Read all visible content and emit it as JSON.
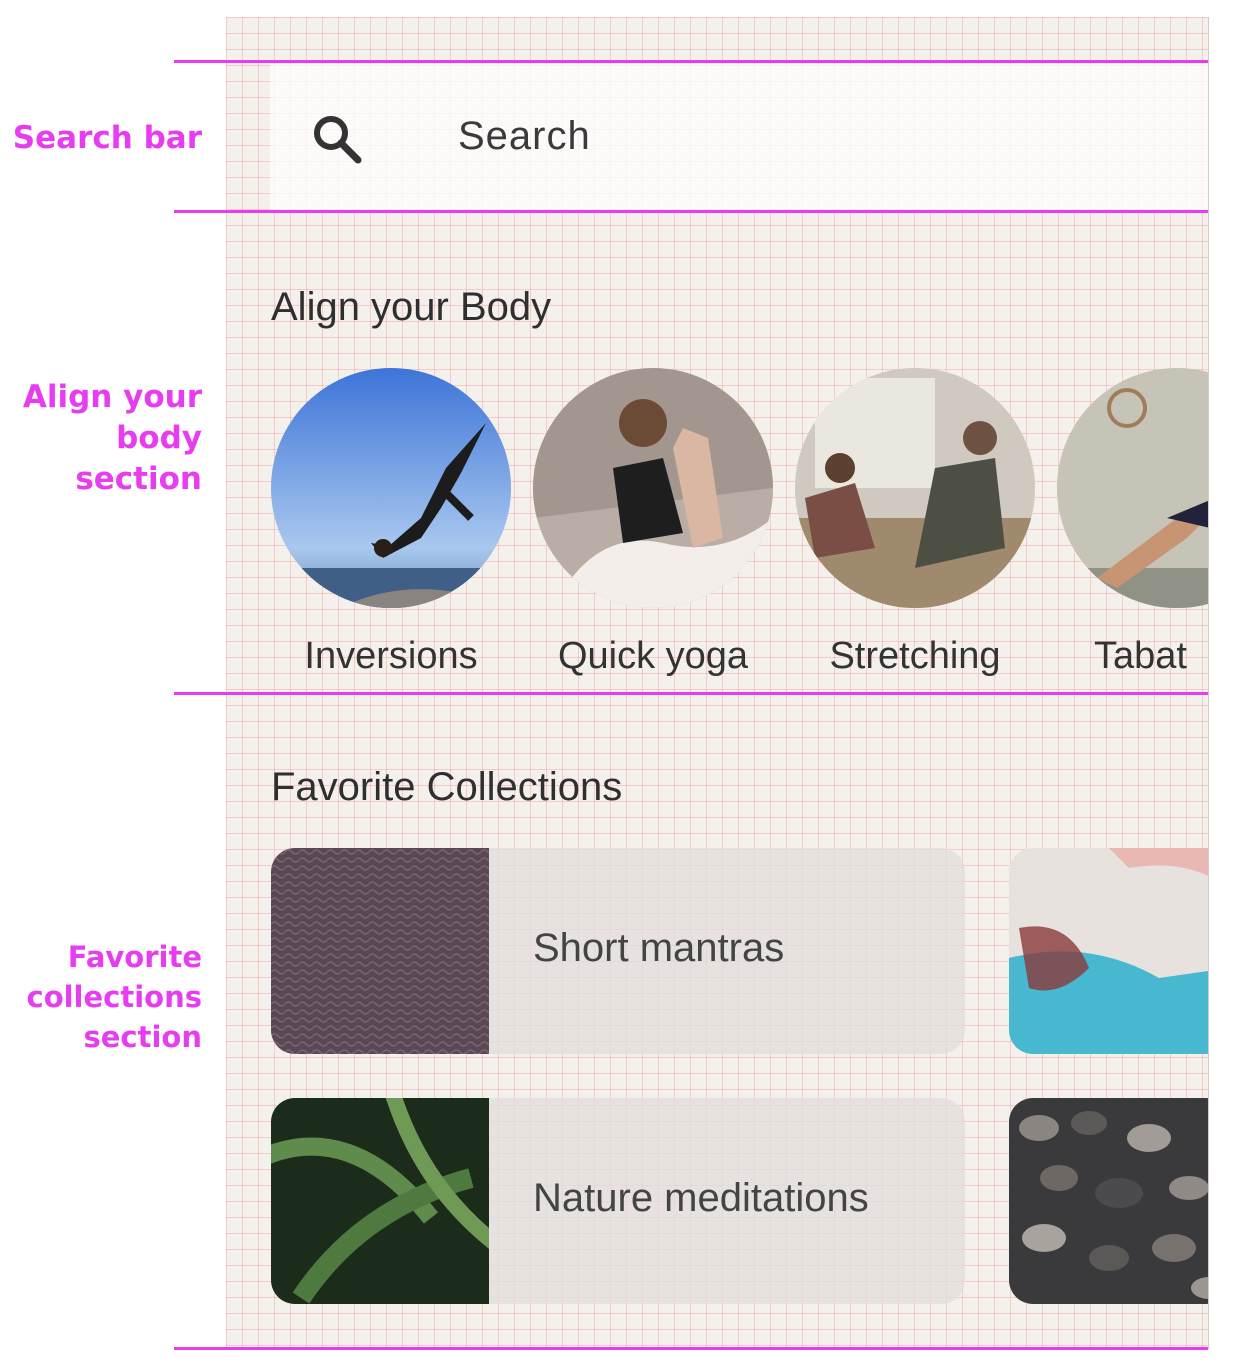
{
  "annotations": {
    "search_bar": "Search bar",
    "align_body": [
      "Align your",
      "body",
      "section"
    ],
    "favorite_collections": [
      "Favorite",
      "collections",
      "section"
    ]
  },
  "search": {
    "placeholder": "Search",
    "icon": "search-icon"
  },
  "align_body": {
    "title": "Align your Body",
    "items": [
      {
        "label": "Inversions"
      },
      {
        "label": "Quick yoga"
      },
      {
        "label": "Stretching"
      },
      {
        "label": "Tabat"
      }
    ]
  },
  "favorite_collections": {
    "title": "Favorite Collections",
    "items": [
      {
        "label": "Short mantras"
      },
      {
        "label": "Nature meditations"
      }
    ]
  },
  "colors": {
    "annotation": "#e83cf0",
    "background": "#f4f0ec",
    "grid": "#ec7878"
  }
}
